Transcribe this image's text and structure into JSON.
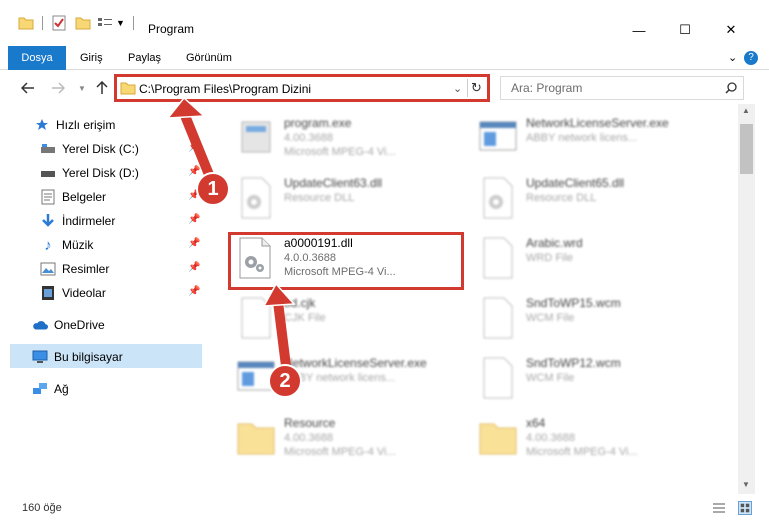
{
  "window": {
    "title": "Program",
    "controls": {
      "minimize": "—",
      "maximize": "☐",
      "close": "✕"
    }
  },
  "ribbon": {
    "tabs": [
      "Dosya",
      "Giriş",
      "Paylaş",
      "Görünüm"
    ],
    "help": "?"
  },
  "nav": {
    "address": "C:\\Program Files\\Program Dizini",
    "search_placeholder": "Ara: Program"
  },
  "sidebar": {
    "items": [
      {
        "label": "Hızlı erişim",
        "icon": "star-icon"
      },
      {
        "label": "Yerel Disk (C:)",
        "icon": "drive-icon",
        "pinned": true
      },
      {
        "label": "Yerel Disk (D:)",
        "icon": "drive-icon",
        "pinned": true
      },
      {
        "label": "Belgeler",
        "icon": "documents-icon",
        "pinned": true
      },
      {
        "label": "İndirmeler",
        "icon": "downloads-icon",
        "pinned": true
      },
      {
        "label": "Müzik",
        "icon": "music-icon",
        "pinned": true
      },
      {
        "label": "Resimler",
        "icon": "pictures-icon",
        "pinned": true
      },
      {
        "label": "Videolar",
        "icon": "videos-icon",
        "pinned": true
      },
      {
        "label": "OneDrive",
        "icon": "cloud-icon"
      },
      {
        "label": "Bu bilgisayar",
        "icon": "computer-icon",
        "selected": true
      },
      {
        "label": "Ağ",
        "icon": "network-icon"
      }
    ]
  },
  "files": [
    {
      "name": "program.exe",
      "line2": "4.00.3688",
      "line3": "Microsoft MPEG-4 Vi...",
      "icon": "exe-icon"
    },
    {
      "name": "NetworkLicenseServer.exe",
      "line2": "ABBY network licens...",
      "line3": "",
      "icon": "exe-window-icon"
    },
    {
      "name": "UpdateClient63.dll",
      "line2": "Resource DLL",
      "line3": "",
      "icon": "dll-gear-icon"
    },
    {
      "name": "UpdateClient65.dll",
      "line2": "Resource DLL",
      "line3": "",
      "icon": "dll-gear-icon"
    },
    {
      "name": "a0000191.dll",
      "line2": "4.0.0.3688",
      "line3": "Microsoft MPEG-4 Vi...",
      "icon": "dll-gear-icon"
    },
    {
      "name": "Arabic.wrd",
      "line2": "WRD File",
      "line3": "",
      "icon": "file-icon"
    },
    {
      "name": "bd.cjk",
      "line2": "CJK File",
      "line3": "",
      "icon": "file-icon"
    },
    {
      "name": "SndToWP15.wcm",
      "line2": "WCM File",
      "line3": "",
      "icon": "file-icon"
    },
    {
      "name": "NetworkLicenseServer.exe",
      "line2": "ABBY network licens...",
      "line3": "",
      "icon": "exe-window-icon"
    },
    {
      "name": "SndToWP12.wcm",
      "line2": "WCM File",
      "line3": "",
      "icon": "file-icon"
    },
    {
      "name": "Resource",
      "line2": "4.00.3688",
      "line3": "Microsoft MPEG-4 Vi...",
      "icon": "folder-icon"
    },
    {
      "name": "x64",
      "line2": "4.00.3688",
      "line3": "Microsoft MPEG-4 Vi...",
      "icon": "folder-icon"
    }
  ],
  "status": {
    "count": "160 öğe"
  },
  "annotations": {
    "step1": "1",
    "step2": "2"
  },
  "colors": {
    "accent": "#1979ca",
    "highlight": "#d33a2f",
    "selection": "#cce4f7"
  }
}
